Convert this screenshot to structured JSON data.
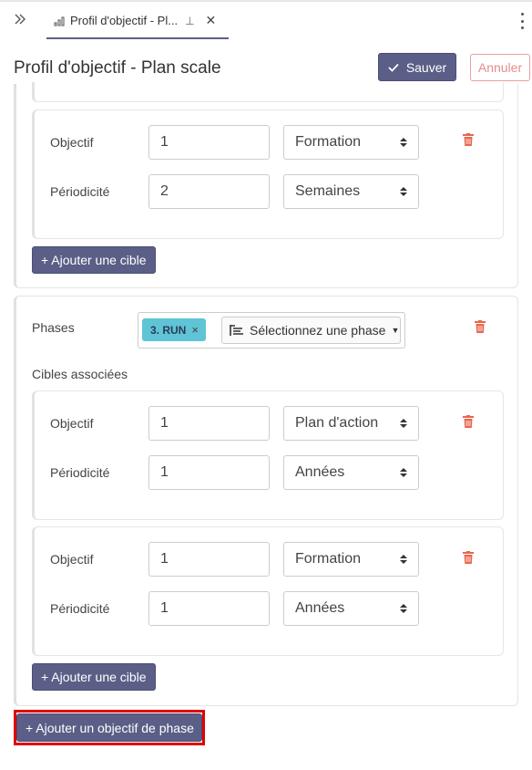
{
  "tab": {
    "title": "Profil d'objectif - Pl..."
  },
  "page": {
    "title": "Profil d'objectif - Plan scale"
  },
  "actions": {
    "save_label": "Sauver",
    "cancel_label": "Annuler"
  },
  "labels": {
    "objectif": "Objectif",
    "periodicite": "Périodicité",
    "phases": "Phases",
    "cibles_associees": "Cibles associées",
    "add_target": "+ Ajouter une cible",
    "add_phase_objective": "+ Ajouter un objectif de phase"
  },
  "phase_block_1": {
    "targets": [
      {
        "objectif_value": "1",
        "objectif_type": "Formation",
        "periodicite_value": "2",
        "periodicite_unit": "Semaines"
      }
    ]
  },
  "phase_block_2": {
    "selected_phase": "3. RUN",
    "phase_placeholder": "Sélectionnez une phase",
    "targets": [
      {
        "objectif_value": "1",
        "objectif_type": "Plan d'action",
        "periodicite_value": "1",
        "periodicite_unit": "Années"
      },
      {
        "objectif_value": "1",
        "objectif_type": "Formation",
        "periodicite_value": "1",
        "periodicite_unit": "Années"
      }
    ]
  },
  "colors": {
    "primary": "#5b5f87",
    "danger": "#e8664d",
    "chip": "#5fc4d6",
    "highlight": "#e00000"
  }
}
